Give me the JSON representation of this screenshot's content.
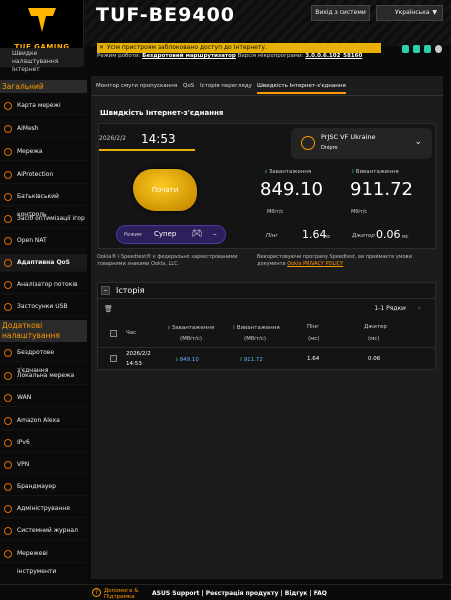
{
  "brand": {
    "model": "TUF-BE9400",
    "logo_text": "TUF GAMING"
  },
  "header": {
    "logout_label": "Вихід з системи",
    "language": "Українська"
  },
  "warning": {
    "text": "Усім пристроям заблоковано доступ до Інтернету.",
    "fw_prefix": "Режим роботи:",
    "fw_mode": "Бездротовий маршрутизатор",
    "fw_version_label": "Версія мікропрограми:",
    "fw_version": "3.0.0.6.102_58160"
  },
  "sidebar": {
    "notice": "Швидке налаштування Інтернет",
    "general_title": "Загальний",
    "general_items": [
      "Карта мережі",
      "AiMesh",
      "Мережа",
      "AiProtection",
      "Батьківський контроль",
      "Засіб оптимізації ігор",
      "Open NAT",
      "Адаптивна QoS",
      "Аналізатор потоків",
      "Застосунки USB"
    ],
    "advanced_title": "Додаткові налаштування",
    "advanced_items": [
      "Бездротове з'єднання",
      "Локальна мережа",
      "WAN",
      "Amazon Alexa",
      "IPv6",
      "VPN",
      "Брандмауер",
      "Адміністрування",
      "Системний журнал",
      "Мережеві інструменти"
    ]
  },
  "tabs": [
    "Монітор смуги пропускання",
    "QoS",
    "Історія перегляду",
    "Швидкість Інтернет-з'єднання"
  ],
  "page_title": "Швидкість Інтернет-з'єднання",
  "test": {
    "date": "2026/2/2",
    "time": "14:53",
    "isp": "PrJSC VF Ukraine",
    "city": "Dnipro",
    "go_label": "Почати",
    "mode_label": "Режим",
    "mode_value": "Супер",
    "mode_extra": "–",
    "download_label": "Завантаження",
    "download_value": "849.10",
    "upload_label": "Вивантаження",
    "upload_value": "911.72",
    "unit": "Мбіт/с",
    "ping_label": "Пінг",
    "ping_value": "1.64",
    "ping_unit": "мс",
    "jitter_label": "Джитер",
    "jitter_value": "0.06",
    "jitter_unit": "мс",
    "footer_left": "Ookla® і Speedtest® є федерально зареєстрованими товарними знаками Ookla, LLC.",
    "footer_right": "Використовуючи програму Speedtest, ви приймаєте умови документа",
    "footer_link": "Ookla PRIVACY POLICY"
  },
  "history": {
    "title": "Історія",
    "rows_text": "1-1 Рядки",
    "columns": [
      "Час",
      "Завантаження",
      "Вивантаження",
      "Пінг",
      "Джитер"
    ],
    "units": [
      "",
      "(Мбіт/с)",
      "(Мбіт/с)",
      "(мс)",
      "(мс)"
    ],
    "rows": [
      {
        "date": "2026/2/2",
        "time": "14:53",
        "download": "849.10",
        "upload": "911.72",
        "ping": "1.64",
        "jitter": "0.06"
      }
    ]
  },
  "footer": {
    "help": "Допомога &",
    "help2": "Підтримка",
    "links": "ASUS Support | Реєстрація продукту | Відгук | FAQ"
  },
  "colors": {
    "accent": "#ff9a00",
    "warning": "#e8b000",
    "go": "#ffc820"
  }
}
